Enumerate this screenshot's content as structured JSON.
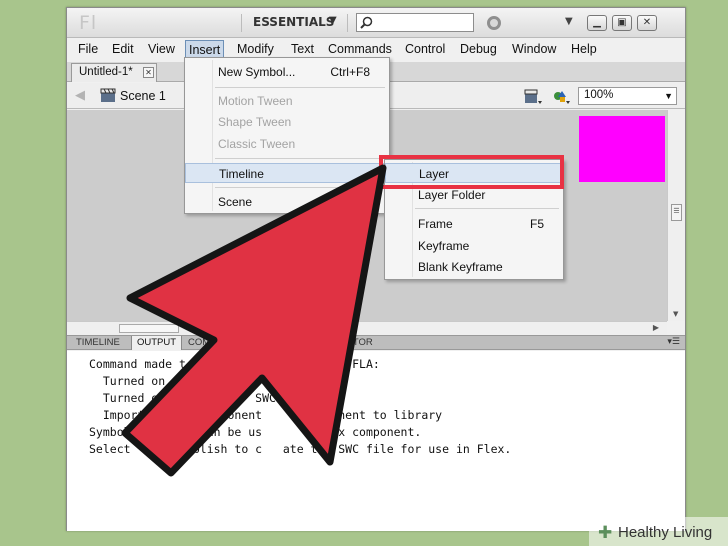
{
  "titlebar": {
    "logo": "Fl",
    "workspace": "ESSENTIALS",
    "workspace_arrow": "▼",
    "min_arrow": "▼",
    "min": "▁",
    "restore": "▣",
    "close": "✕"
  },
  "menubar": {
    "items": [
      "File",
      "Edit",
      "View",
      "Insert",
      "Modify",
      "Text",
      "Commands",
      "Control",
      "Debug",
      "Window",
      "Help"
    ]
  },
  "document_tab": {
    "label": "Untitled-1*",
    "close": "✕"
  },
  "editbar": {
    "back": "◀",
    "scene_label": "Scene 1",
    "zoom": "100%",
    "zoom_arrow": "▼"
  },
  "insert_menu": {
    "new_symbol": {
      "label": "New Symbol...",
      "shortcut": "Ctrl+F8"
    },
    "motion_tween": "Motion Tween",
    "shape_tween": "Shape Tween",
    "classic_tween": "Classic Tween",
    "timeline": "Timeline",
    "scene": "Scene"
  },
  "timeline_submenu": {
    "layer": "Layer",
    "layer_folder": "Layer Folder",
    "frame": {
      "label": "Frame",
      "shortcut": "F5"
    },
    "keyframe": "Keyframe",
    "blank_keyframe": "Blank Keyframe"
  },
  "panel_tabs": [
    "TIMELINE",
    "OUTPUT",
    "COM",
    "EDITOR"
  ],
  "output": {
    "lines": [
      "Command made t             ges to the FLA:",
      "  Turned on",
      "  Turned o              SWC",
      "  Importe          ponent      component to library",
      "Symbol           an be us      a Flex component.",
      "Select       Publish to c   ate the SWC file for use in Flex."
    ]
  },
  "watermark": {
    "plus": "✚",
    "text": "Healthy Living"
  },
  "colors": {
    "arrow": "#e03243",
    "artboard": "#ff00ff",
    "highlight": "#e83243"
  }
}
